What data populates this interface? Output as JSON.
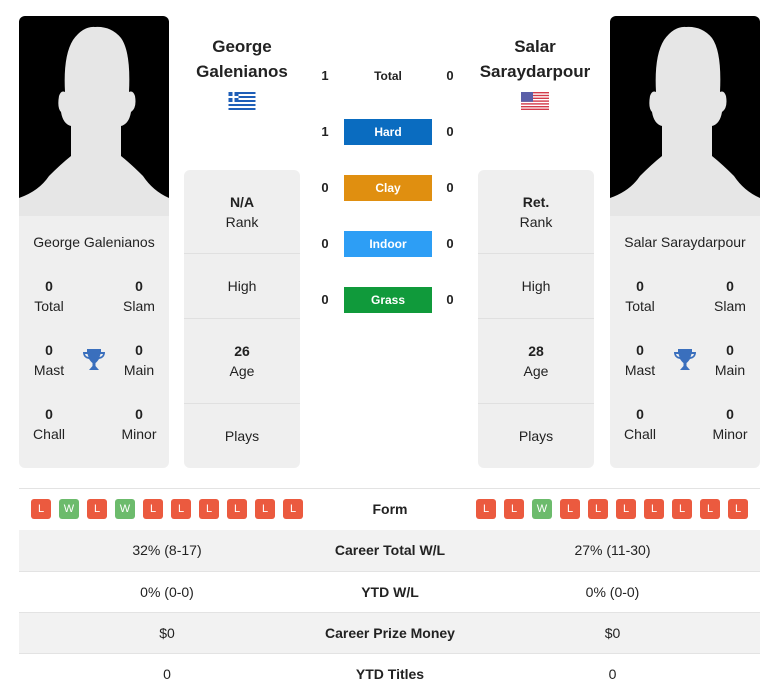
{
  "colors": {
    "hard": "#0a6cc0",
    "clay": "#e08f10",
    "indoor": "#2d9ef5",
    "grass": "#109a3b",
    "loss": "#eb5a3f",
    "win": "#6cbb6c",
    "trophy": "#3a6fbd"
  },
  "player1": {
    "name_line1": "George",
    "name_line2": "Galenianos",
    "full_name": "George Galenianos",
    "flag": "greece-flag",
    "rank_value": "N/A",
    "rank_label": "Rank",
    "high_label": "High",
    "age_value": "26",
    "age_label": "Age",
    "plays_label": "Plays",
    "titles": {
      "total": "0",
      "total_label": "Total",
      "slam": "0",
      "slam_label": "Slam",
      "mast": "0",
      "mast_label": "Mast",
      "main": "0",
      "main_label": "Main",
      "chall": "0",
      "chall_label": "Chall",
      "minor": "0",
      "minor_label": "Minor"
    },
    "form": [
      "L",
      "W",
      "L",
      "W",
      "L",
      "L",
      "L",
      "L",
      "L",
      "L"
    ]
  },
  "player2": {
    "name_line1": "Salar",
    "name_line2": "Saraydarpour",
    "full_name": "Salar Saraydarpour",
    "flag": "usa-flag",
    "rank_value": "Ret.",
    "rank_label": "Rank",
    "high_label": "High",
    "age_value": "28",
    "age_label": "Age",
    "plays_label": "Plays",
    "titles": {
      "total": "0",
      "total_label": "Total",
      "slam": "0",
      "slam_label": "Slam",
      "mast": "0",
      "mast_label": "Mast",
      "main": "0",
      "main_label": "Main",
      "chall": "0",
      "chall_label": "Chall",
      "minor": "0",
      "minor_label": "Minor"
    },
    "form": [
      "L",
      "L",
      "W",
      "L",
      "L",
      "L",
      "L",
      "L",
      "L",
      "L"
    ]
  },
  "h2h": [
    {
      "label": "Total",
      "p1": "1",
      "p2": "0",
      "key": "total"
    },
    {
      "label": "Hard",
      "p1": "1",
      "p2": "0",
      "key": "hard"
    },
    {
      "label": "Clay",
      "p1": "0",
      "p2": "0",
      "key": "clay"
    },
    {
      "label": "Indoor",
      "p1": "0",
      "p2": "0",
      "key": "indoor"
    },
    {
      "label": "Grass",
      "p1": "0",
      "p2": "0",
      "key": "grass"
    }
  ],
  "form_label": "Form",
  "comparison": [
    {
      "label": "Career Total W/L",
      "p1": "32% (8-17)",
      "p2": "27% (11-30)"
    },
    {
      "label": "YTD W/L",
      "p1": "0% (0-0)",
      "p2": "0% (0-0)"
    },
    {
      "label": "Career Prize Money",
      "p1": "$0",
      "p2": "$0"
    },
    {
      "label": "YTD Titles",
      "p1": "0",
      "p2": "0"
    }
  ]
}
